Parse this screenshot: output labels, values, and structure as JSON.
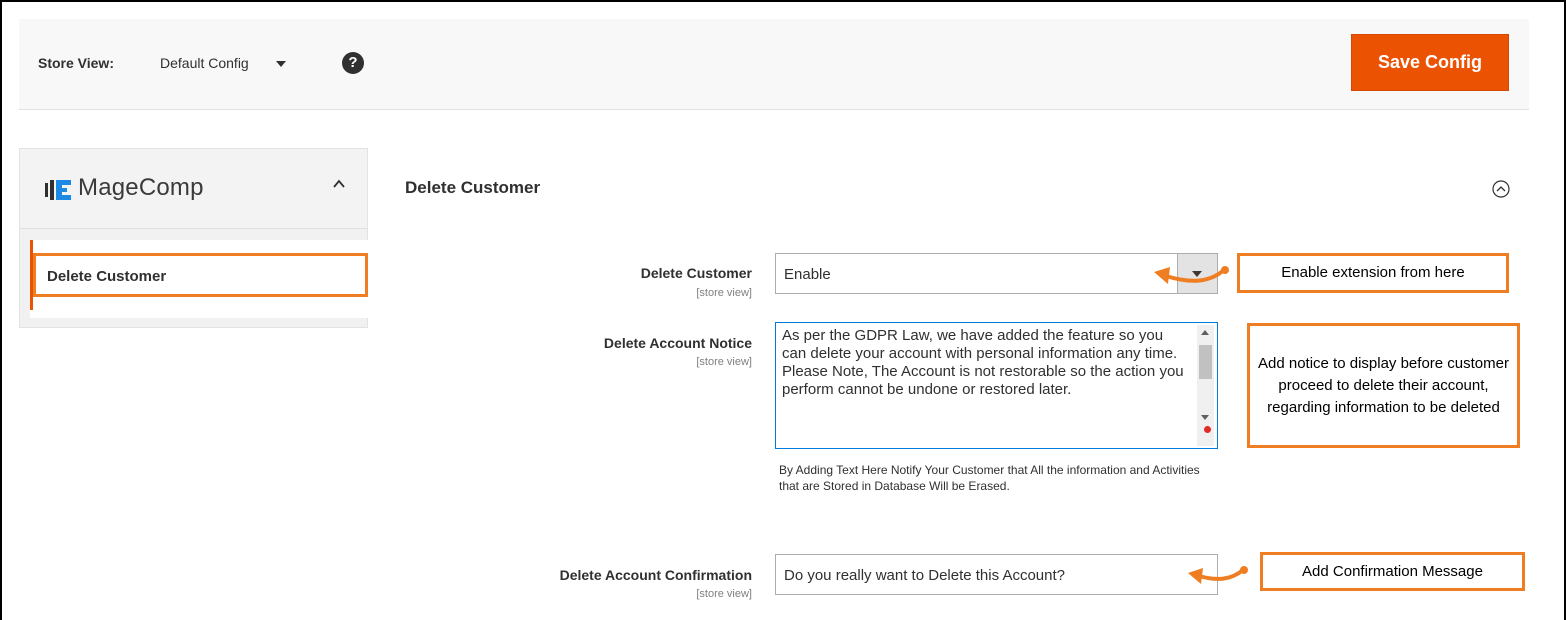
{
  "header": {
    "store_view_label": "Store View:",
    "store_view_value": "Default Config",
    "help_icon": "?",
    "save_label": "Save Config"
  },
  "sidebar": {
    "brand": "MageComp",
    "items": [
      {
        "label": "Delete Customer",
        "active": true
      }
    ]
  },
  "section": {
    "title": "Delete Customer",
    "fields": [
      {
        "label": "Delete Customer",
        "scope": "[store view]",
        "value": "Enable"
      },
      {
        "label": "Delete Account Notice",
        "scope": "[store view]",
        "value": "As per the GDPR Law, we have added the feature so you can delete your account with personal information any time.\nPlease Note, The Account is not restorable so the action you perform cannot be undone or restored later.",
        "comment": "By Adding Text Here Notify Your Customer that All the information and Activities that are Stored in Database Will be Erased."
      },
      {
        "label": "Delete Account Confirmation",
        "scope": "[store view]",
        "value": "Do you really want to Delete this Account?"
      }
    ]
  },
  "callouts": [
    "Enable extension from here",
    "Add notice to display before customer proceed to delete their account, regarding information to be deleted",
    "Add Confirmation Message"
  ],
  "colors": {
    "accent": "#eb5202",
    "callout_border": "#ef7d21",
    "focus_border": "#007bdb"
  },
  "icons": {
    "help": "question-circle-icon",
    "sidebar_toggle": "chevron-up-icon",
    "section_toggle": "collapse-circle-icon",
    "select_arrow": "caret-down-icon"
  }
}
